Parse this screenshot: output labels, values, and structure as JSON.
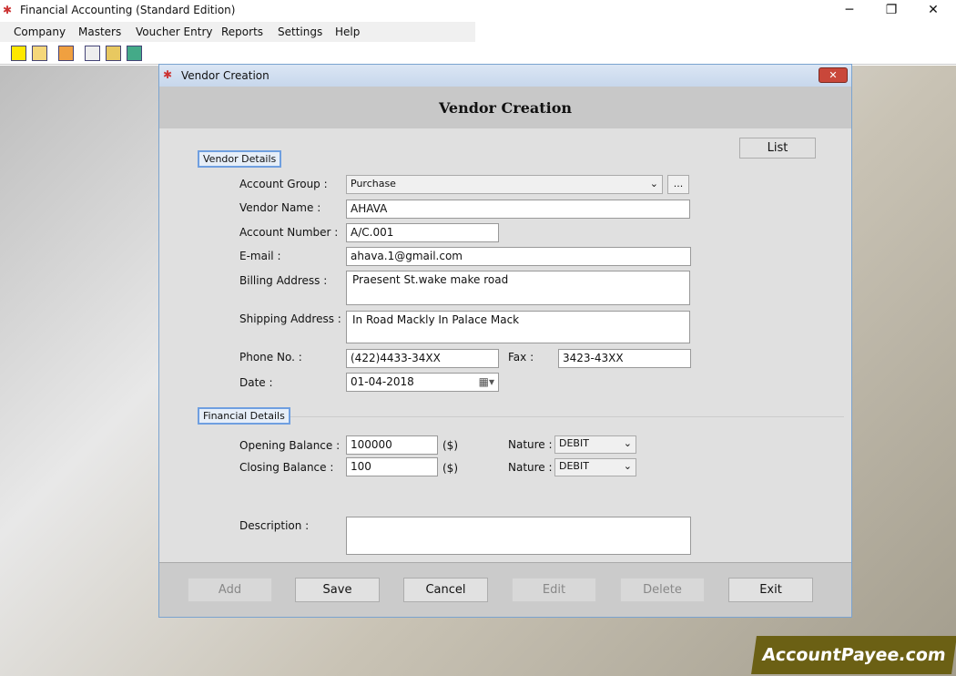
{
  "app": {
    "title": "Financial Accounting (Standard Edition)",
    "window_controls": [
      "minimize",
      "maximize",
      "close"
    ]
  },
  "menu": [
    "Company",
    "Masters",
    "Voucher Entry",
    "Reports",
    "Settings",
    "Help"
  ],
  "toolbar_icons": [
    "new-icon",
    "open-icon",
    "calendar-icon",
    "balance-icon",
    "voucher-icon",
    "add-list-icon"
  ],
  "dialog": {
    "title": "Vendor Creation",
    "heading": "Vendor Creation",
    "list_label": "List",
    "close_label": "x",
    "vendor_details_label": "Vendor Details",
    "account_group_label": "Account Group :",
    "account_group": "Purchase",
    "browse_label": "...",
    "vendor_name_label": "Vendor Name :",
    "vendor_name": "AHAVA",
    "account_number_label": "Account Number :",
    "account_number": "A/C.001",
    "email_label": "E-mail :",
    "email": "ahava.1@gmail.com",
    "billing_label": "Billing Address :",
    "billing": "Praesent St.wake make road",
    "shipping_label": "Shipping Address :",
    "shipping": "In Road Mackly In Palace Mack",
    "phone_label": "Phone No. :",
    "phone": "(422)4433-34XX",
    "fax_label": "Fax :",
    "fax": "3423-43XX",
    "date_label": "Date :",
    "date": "01-04-2018",
    "financial_details_label": "Financial Details",
    "opening_label": "Opening Balance :",
    "opening": "100000",
    "closing_label": "Closing Balance :",
    "closing": "100",
    "currency": "($)",
    "nature_label": "Nature :",
    "opening_nature": "DEBIT",
    "closing_nature": "DEBIT",
    "description_label": "Description :",
    "description": ""
  },
  "buttons": {
    "add": "Add",
    "save": "Save",
    "cancel": "Cancel",
    "edit": "Edit",
    "delete": "Delete",
    "exit": "Exit"
  },
  "watermark": "AccountPayee.com"
}
